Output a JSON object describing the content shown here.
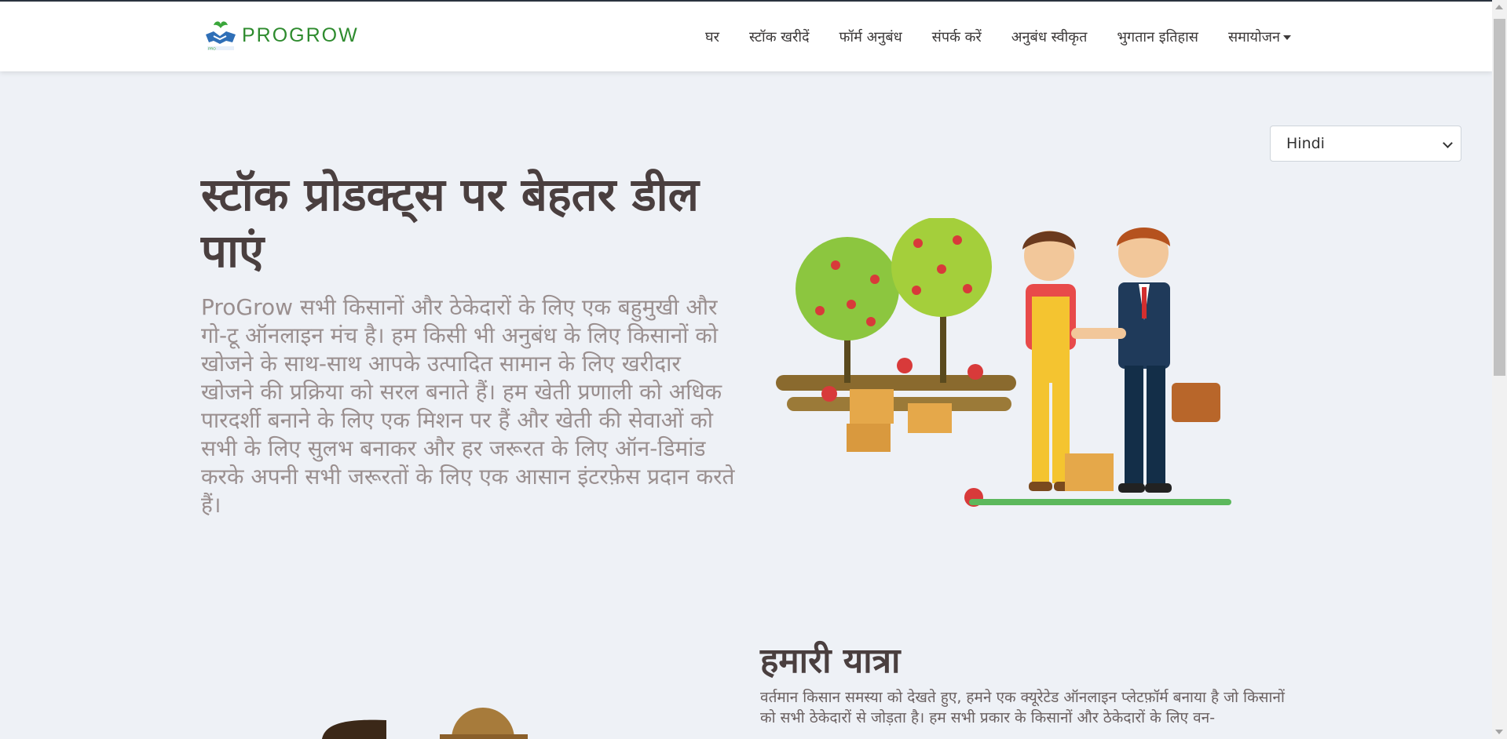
{
  "brand": {
    "name": "PROGROW",
    "logo_caption": "PRO"
  },
  "nav": {
    "items": [
      {
        "label": "घर"
      },
      {
        "label": "स्टॉक खरीदें"
      },
      {
        "label": "फॉर्म अनुबंध"
      },
      {
        "label": "संपर्क करें"
      },
      {
        "label": "अनुबंध स्वीकृत"
      },
      {
        "label": "भुगतान इतिहास"
      },
      {
        "label": "समायोजन"
      }
    ]
  },
  "language": {
    "selected": "Hindi"
  },
  "hero": {
    "title": "स्टॉक प्रोडक्ट्स पर बेहतर डील पाएं",
    "description": "ProGrow सभी किसानों और ठेकेदारों के लिए एक बहुमुखी और गो-टू ऑनलाइन मंच है। हम किसी भी अनुबंध के लिए किसानों को खोजने के साथ-साथ आपके उत्पादित सामान के लिए खरीदार खोजने की प्रक्रिया को सरल बनाते हैं। हम खेती प्रणाली को अधिक पारदर्शी बनाने के लिए एक मिशन पर हैं और खेती की सेवाओं को सभी के लिए सुलभ बनाकर और हर जरूरत के लिए ऑन-डिमांड करके अपनी सभी जरूरतों के लिए एक आसान इंटरफ़ेस प्रदान करते हैं।"
  },
  "journey": {
    "title": "हमारी यात्रा",
    "text": "वर्तमान किसान समस्या को देखते हुए, हमने एक क्यूरेटेड ऑनलाइन प्लेटफ़ॉर्म बनाया है जो किसानों को सभी ठेकेदारों से जोड़ता है। हम सभी प्रकार के किसानों और ठेकेदारों के लिए वन-"
  },
  "colors": {
    "brand_green": "#2e8b2e",
    "page_bg": "#eef1f6",
    "heading": "#4a3f3f",
    "muted_text": "#9a8f8f"
  }
}
